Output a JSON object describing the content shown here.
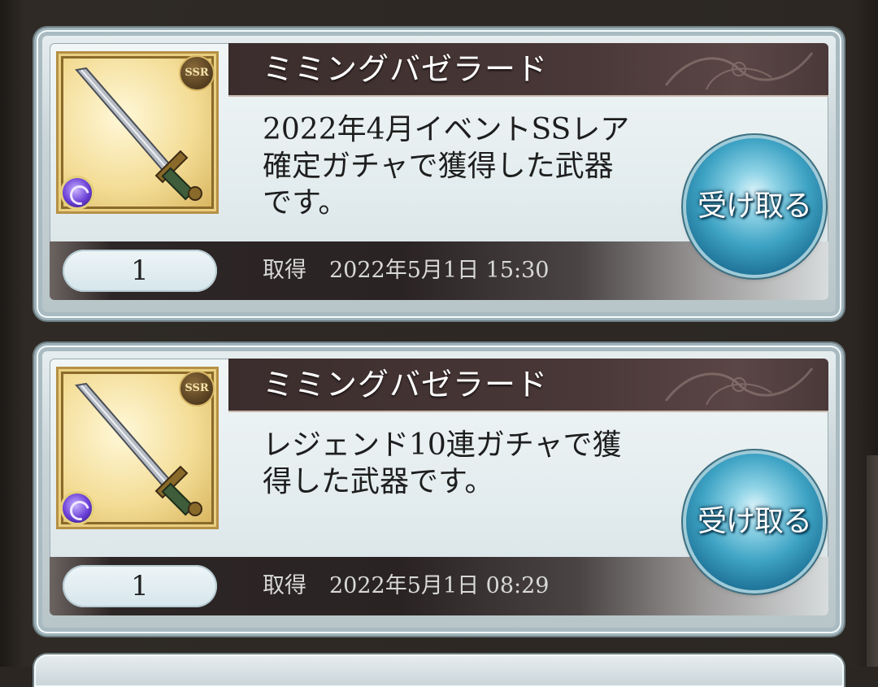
{
  "items": [
    {
      "name": "ミミングバゼラード",
      "rarity_badge": "SSR",
      "description_lines": [
        "2022年4月イベントSSレア",
        "確定ガチャで獲得した武器",
        "です。"
      ],
      "count": "1",
      "acquired_label": "取得",
      "acquired_date": "2022年5月1日 15:30",
      "button_label": "受け取る"
    },
    {
      "name": "ミミングバゼラード",
      "rarity_badge": "SSR",
      "description_lines": [
        "レジェンド10連ガチャで獲",
        "得した武器です。"
      ],
      "count": "1",
      "acquired_label": "取得",
      "acquired_date": "2022年5月1日 08:29",
      "button_label": "受け取る"
    }
  ]
}
